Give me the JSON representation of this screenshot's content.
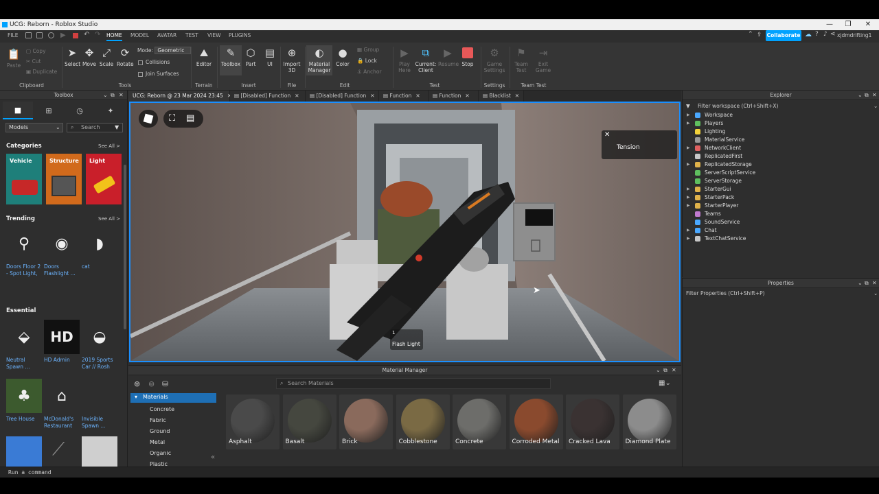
{
  "window": {
    "title": "UCG: Reborn - Roblox Studio",
    "minimize": "—",
    "maximize": "❐",
    "close": "✕"
  },
  "menubar": {
    "file": "FILE",
    "tabs": [
      "HOME",
      "MODEL",
      "AVATAR",
      "TEST",
      "VIEW",
      "PLUGINS"
    ],
    "active_tab": "HOME",
    "collaborate": "Collaborate",
    "username": "xjdmdrifting1"
  },
  "ribbon": {
    "clipboard": {
      "paste": "Paste",
      "copy": "Copy",
      "cut": "Cut",
      "duplicate": "Duplicate",
      "label": "Clipboard"
    },
    "tools": {
      "select": "Select",
      "move": "Move",
      "scale": "Scale",
      "rotate": "Rotate",
      "mode_label": "Mode:",
      "mode_value": "Geometric",
      "collisions": "Collisions",
      "join_surfaces": "Join Surfaces",
      "label": "Tools"
    },
    "terrain": {
      "editor": "Editor",
      "label": "Terrain"
    },
    "insert": {
      "toolbox": "Toolbox",
      "part": "Part",
      "ui": "UI",
      "label": "Insert"
    },
    "file": {
      "import3d_line1": "Import",
      "import3d_line2": "3D",
      "label": "File"
    },
    "edit": {
      "material_line1": "Material",
      "material_line2": "Manager",
      "color": "Color",
      "group": "Group",
      "lock": "Lock",
      "anchor": "Anchor",
      "label": "Edit"
    },
    "test": {
      "play_line1": "Play",
      "play_line2": "Here",
      "current_line1": "Current:",
      "current_line2": "Client",
      "resume": "Resume",
      "stop": "Stop",
      "label": "Test"
    },
    "settings": {
      "game_line1": "Game",
      "game_line2": "Settings",
      "label": "Settings"
    },
    "team_test": {
      "team_line1": "Team",
      "team_line2": "Test",
      "exit_line1": "Exit",
      "exit_line2": "Game",
      "label": "Team Test"
    }
  },
  "toolbox": {
    "title": "Toolbox",
    "category_select": "Models",
    "search_placeholder": "Search",
    "categories_title": "Categories",
    "categories_seeall": "See All >",
    "categories": [
      "Vehicle",
      "Structure",
      "Light"
    ],
    "trending_title": "Trending",
    "trending_seeall": "See All >",
    "trending": [
      {
        "line1": "Doors Floor 2",
        "line2": "- Spot Light,"
      },
      {
        "line1": "Doors",
        "line2": "Flashlight ..."
      },
      {
        "line1": "cat",
        "line2": ""
      }
    ],
    "essential_title": "Essential",
    "essential": [
      {
        "line1": "Neutral",
        "line2": "Spawn ..."
      },
      {
        "line1": "HD Admin",
        "line2": "",
        "thumb_text": "HD"
      },
      {
        "line1": "2019 Sports",
        "line2": "Car // Rosh"
      },
      {
        "line1": "Tree House",
        "line2": ""
      },
      {
        "line1": "McDonald's",
        "line2": "Restaurant"
      },
      {
        "line1": "Invisible",
        "line2": "Spawn ..."
      }
    ]
  },
  "tabs": [
    {
      "label": "UCG: Reborn @ 23 Mar 2024 23:45",
      "active": true
    },
    {
      "label": "[Disabled] Function"
    },
    {
      "label": "[Disabled] Function"
    },
    {
      "label": "Function"
    },
    {
      "label": "Function"
    },
    {
      "label": "Blacklist"
    }
  ],
  "tab_close": "✕",
  "viewport": {
    "tension_label": "Tension",
    "tension_close": "✕",
    "hotbar_slot": "1",
    "hotbar_item": "Flash Light"
  },
  "explorer": {
    "title": "Explorer",
    "filter_placeholder": "Filter workspace (Ctrl+Shift+X)",
    "items": [
      {
        "name": "Workspace",
        "expandable": true,
        "color": "#4aa8ff"
      },
      {
        "name": "Players",
        "expandable": true,
        "color": "#5fbf5f"
      },
      {
        "name": "Lighting",
        "expandable": false,
        "color": "#f2d13a"
      },
      {
        "name": "MaterialService",
        "expandable": false,
        "color": "#9a9a9a"
      },
      {
        "name": "NetworkClient",
        "expandable": true,
        "color": "#e06060"
      },
      {
        "name": "ReplicatedFirst",
        "expandable": false,
        "color": "#c8c8c8"
      },
      {
        "name": "ReplicatedStorage",
        "expandable": true,
        "color": "#e0b24a"
      },
      {
        "name": "ServerScriptService",
        "expandable": false,
        "color": "#5fbf5f"
      },
      {
        "name": "ServerStorage",
        "expandable": false,
        "color": "#5fbf5f"
      },
      {
        "name": "StarterGui",
        "expandable": true,
        "color": "#e0b24a"
      },
      {
        "name": "StarterPack",
        "expandable": true,
        "color": "#e0b24a"
      },
      {
        "name": "StarterPlayer",
        "expandable": true,
        "color": "#e0b24a"
      },
      {
        "name": "Teams",
        "expandable": false,
        "color": "#c07ad0"
      },
      {
        "name": "SoundService",
        "expandable": false,
        "color": "#4aa8ff"
      },
      {
        "name": "Chat",
        "expandable": true,
        "color": "#4aa8ff"
      },
      {
        "name": "TextChatService",
        "expandable": true,
        "color": "#c8c8c8"
      }
    ]
  },
  "properties": {
    "title": "Properties",
    "filter_placeholder": "Filter Properties (Ctrl+Shift+P)"
  },
  "material_manager": {
    "title": "Material Manager",
    "search_placeholder": "Search Materials",
    "tree_root": "Materials",
    "tree_items": [
      "Concrete",
      "Fabric",
      "Ground",
      "Metal",
      "Organic",
      "Plastic"
    ],
    "materials": [
      {
        "name": "Asphalt",
        "color": "#4a4a4a"
      },
      {
        "name": "Basalt",
        "color": "#45473f"
      },
      {
        "name": "Brick",
        "color": "#8a6a5c"
      },
      {
        "name": "Cobblestone",
        "color": "#7a6a44"
      },
      {
        "name": "Concrete",
        "color": "#6d6d6a"
      },
      {
        "name": "Corroded Metal",
        "color": "#8a4a2e"
      },
      {
        "name": "Cracked Lava",
        "color": "#3a3232"
      },
      {
        "name": "Diamond Plate",
        "color": "#8c8c8c"
      }
    ]
  },
  "command_bar": {
    "placeholder": "Run a command"
  }
}
